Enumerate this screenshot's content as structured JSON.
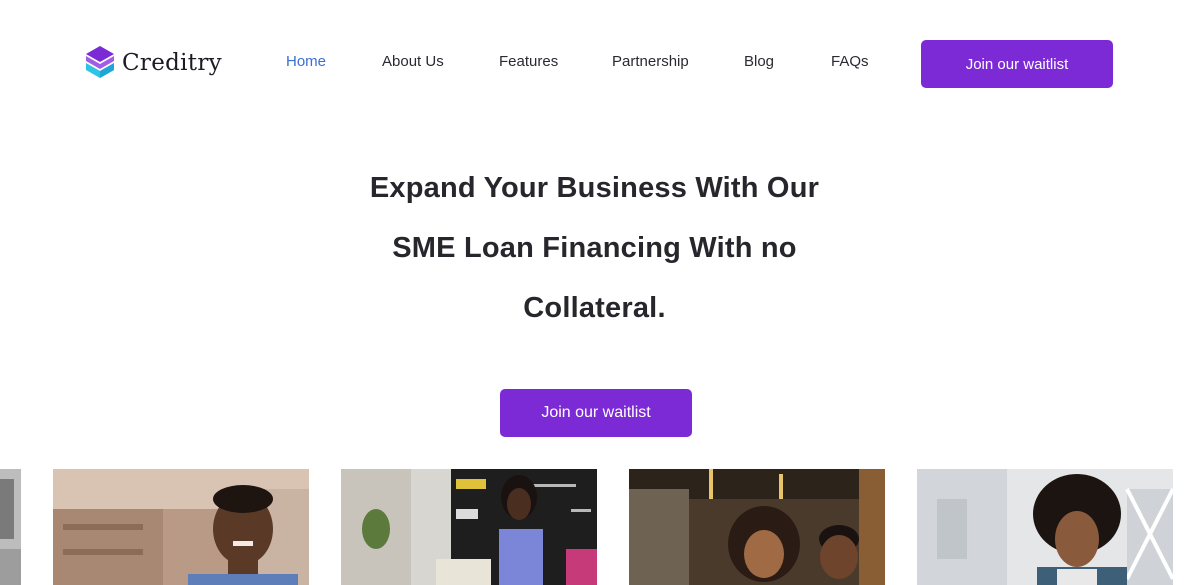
{
  "brand": {
    "name": "Creditry",
    "colors": {
      "accent": "#7b2ad6",
      "nav_active": "#3b6fd1",
      "logo_purple": "#7b2ad6",
      "logo_cyan": "#2ec4e6"
    }
  },
  "nav": {
    "items": [
      {
        "label": "Home",
        "active": true
      },
      {
        "label": "About Us",
        "active": false
      },
      {
        "label": "Features",
        "active": false
      },
      {
        "label": "Partnership",
        "active": false
      },
      {
        "label": "Blog",
        "active": false
      },
      {
        "label": "FAQs",
        "active": false
      }
    ],
    "cta_label": "Join our waitlist"
  },
  "hero": {
    "title_lines": [
      "Expand Your Business With Our",
      "SME Loan Financing With no",
      "Collateral."
    ],
    "cta_label": "Join our waitlist"
  },
  "photos": [
    {
      "subject": "partial-photo"
    },
    {
      "subject": "smiling-man-in-shop"
    },
    {
      "subject": "woman-in-cafe-with-chalkboard"
    },
    {
      "subject": "couple-smiling"
    },
    {
      "subject": "woman-with-curly-hair"
    }
  ]
}
